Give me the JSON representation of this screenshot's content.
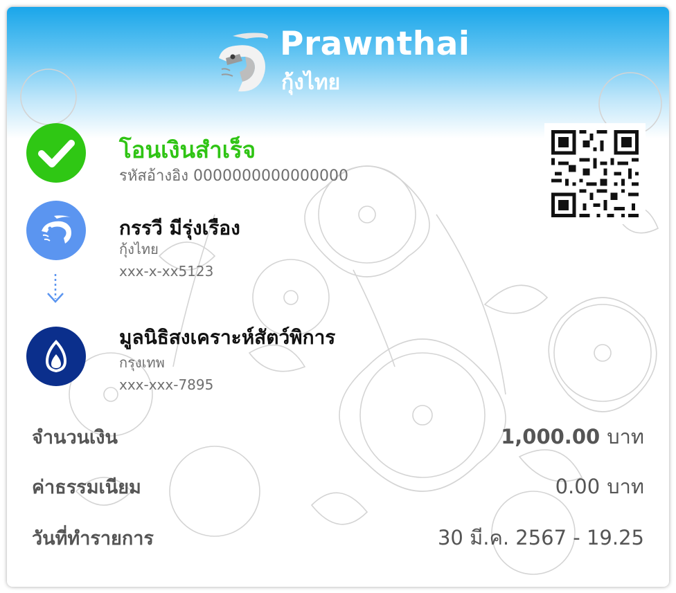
{
  "brand": {
    "name_en": "Prawnthai",
    "name_th": "กุ้งไทย"
  },
  "status": {
    "title": "โอนเงินสำเร็จ",
    "ref_label": "รหัสอ้างอิง",
    "ref_number": "0000000000000000"
  },
  "sender": {
    "name": "กรรวี มีรุ่งเรือง",
    "bank": "กุ้งไทย",
    "account": "xxx-x-xx5123"
  },
  "receiver": {
    "name": "มูลนิธิสงเคราะห์สัตว์พิการ",
    "bank": "กรุงเทพ",
    "account": "xxx-xxx-7895"
  },
  "details": {
    "amount_label": "จำนวนเงิน",
    "amount_value": "1,000.00",
    "amount_unit": "บาท",
    "fee_label": "ค่าธรรมเนียม",
    "fee_value": "0.00",
    "fee_unit": "บาท",
    "date_label": "วันที่ทำรายการ",
    "date_value": "30 มี.ค. 2567 - 19.25"
  },
  "icons": {
    "logo": "prawn-logo-icon",
    "status": "checkmark-icon",
    "sender_bank": "prawn-bank-icon",
    "arrow": "arrow-down-dotted-icon",
    "receiver_bank": "lotus-bank-icon",
    "qr": "qr-code"
  },
  "colors": {
    "header": "#1aa6ea",
    "success": "#2fc714",
    "sender_bank": "#5b95f0",
    "receiver_bank": "#0b2f8c"
  }
}
